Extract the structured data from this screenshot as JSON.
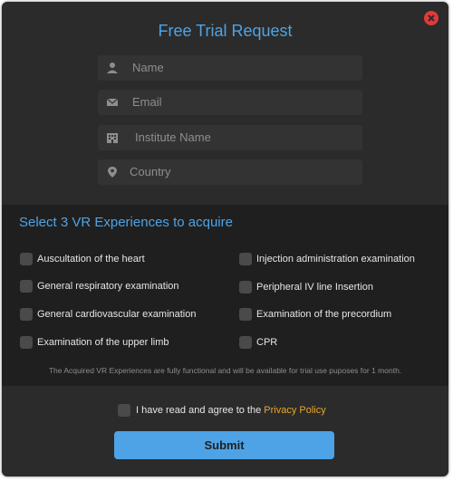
{
  "modal": {
    "title": "Free Trial Request",
    "close_icon": "close-circle-icon"
  },
  "form": {
    "fields": [
      {
        "placeholder": "Name",
        "icon": "user-icon"
      },
      {
        "placeholder": "Email",
        "icon": "envelope-icon"
      },
      {
        "placeholder": "Institute Name",
        "icon": "building-icon"
      },
      {
        "placeholder": "Country",
        "icon": "map-pin-icon"
      }
    ]
  },
  "experiences": {
    "title": "Select 3 VR Experiences to acquire",
    "left": [
      "Auscultation of the heart",
      "General respiratory examination",
      "General cardiovascular examination",
      "Examination of the upper limb"
    ],
    "right": [
      "Injection administration examination",
      "Peripheral IV line Insertion",
      "Examination of the precordium",
      "CPR"
    ],
    "note": "The Acquired VR Experiences are fully functional and will be available for trial use puposes for 1 month."
  },
  "agreement": {
    "text": "I have read and agree to the ",
    "link": "Privacy Policy"
  },
  "submit": {
    "label": "Submit"
  },
  "colors": {
    "accent": "#4ea3e6",
    "link": "#e8a82e",
    "close": "#e03a3a",
    "background": "#2b2b2b"
  }
}
